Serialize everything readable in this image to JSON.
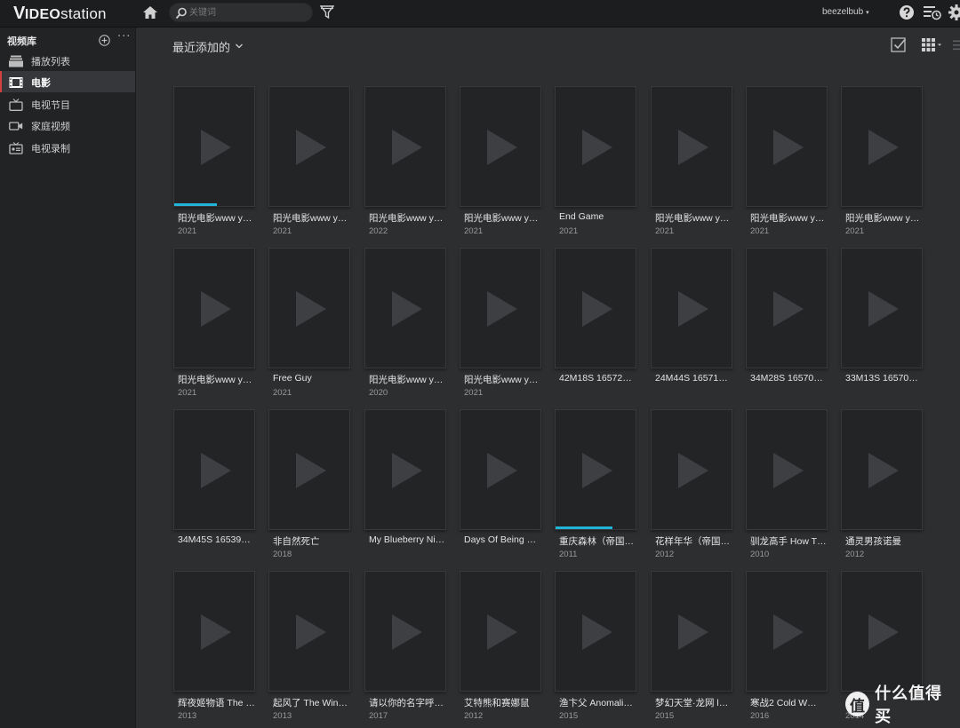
{
  "app": {
    "logo_v": "V",
    "logo_ideo": "IDEO",
    "logo_station": "station"
  },
  "search": {
    "placeholder": "关键词"
  },
  "user": {
    "name": "beezelbub",
    "caret": "▾"
  },
  "sidebar": {
    "title": "视频库",
    "more": "···",
    "items": [
      {
        "label": "播放列表",
        "icon": "playlist-icon"
      },
      {
        "label": "电影",
        "icon": "movie-icon",
        "active": true
      },
      {
        "label": "电视节目",
        "icon": "tv-icon"
      },
      {
        "label": "家庭视频",
        "icon": "camera-icon"
      },
      {
        "label": "电视录制",
        "icon": "recorder-icon"
      }
    ]
  },
  "main": {
    "view_title": "最近添加的",
    "movies": [
      {
        "title": "阳光电影www y…",
        "year": "2021",
        "progress": 0.53
      },
      {
        "title": "阳光电影www y…",
        "year": "2021"
      },
      {
        "title": "阳光电影www y…",
        "year": "2022"
      },
      {
        "title": "阳光电影www y…",
        "year": "2021"
      },
      {
        "title": "End Game",
        "year": "2021"
      },
      {
        "title": "阳光电影www y…",
        "year": "2021"
      },
      {
        "title": "阳光电影www y…",
        "year": "2021"
      },
      {
        "title": "阳光电影www y…",
        "year": "2021"
      },
      {
        "title": "阳光电影www y…",
        "year": "2021"
      },
      {
        "title": "Free Guy",
        "year": "2021"
      },
      {
        "title": "阳光电影www y…",
        "year": "2020"
      },
      {
        "title": "阳光电影www y…",
        "year": "2021"
      },
      {
        "title": "42M18S 16572…",
        "year": ""
      },
      {
        "title": "24M44S 16571…",
        "year": ""
      },
      {
        "title": "34M28S 16570…",
        "year": ""
      },
      {
        "title": "33M13S 16570…",
        "year": ""
      },
      {
        "title": "34M45S 16539…",
        "year": ""
      },
      {
        "title": "非自然死亡",
        "year": "2018"
      },
      {
        "title": "My Blueberry Ni…",
        "year": ""
      },
      {
        "title": "Days Of Being …",
        "year": ""
      },
      {
        "title": "重庆森林（帝国…",
        "year": "2011",
        "progress": 0.71
      },
      {
        "title": "花样年华（帝国…",
        "year": "2012"
      },
      {
        "title": "驯龙高手 How T…",
        "year": "2010"
      },
      {
        "title": "通灵男孩诺曼",
        "year": "2012"
      },
      {
        "title": "辉夜姬物语 The …",
        "year": "2013"
      },
      {
        "title": "起风了 The Win…",
        "year": "2013"
      },
      {
        "title": "请以你的名字呼…",
        "year": "2017"
      },
      {
        "title": "艾特熊和赛娜鼠",
        "year": "2012"
      },
      {
        "title": "渔卞父 Anomali…",
        "year": "2015"
      },
      {
        "title": "梦幻天堂·龙网 l…",
        "year": "2015"
      },
      {
        "title": "寒战2 Cold W…",
        "year": "2016"
      },
      {
        "title": "",
        "year": "2014"
      }
    ]
  },
  "watermark": {
    "badge": "值",
    "text": "什么值得买"
  },
  "colors": {
    "accent_progress": "#22b4d8",
    "active_marker": "#d34040",
    "topbar": "#1c1d1f",
    "sidebar": "#222325",
    "main_bg": "#2c2e30"
  }
}
